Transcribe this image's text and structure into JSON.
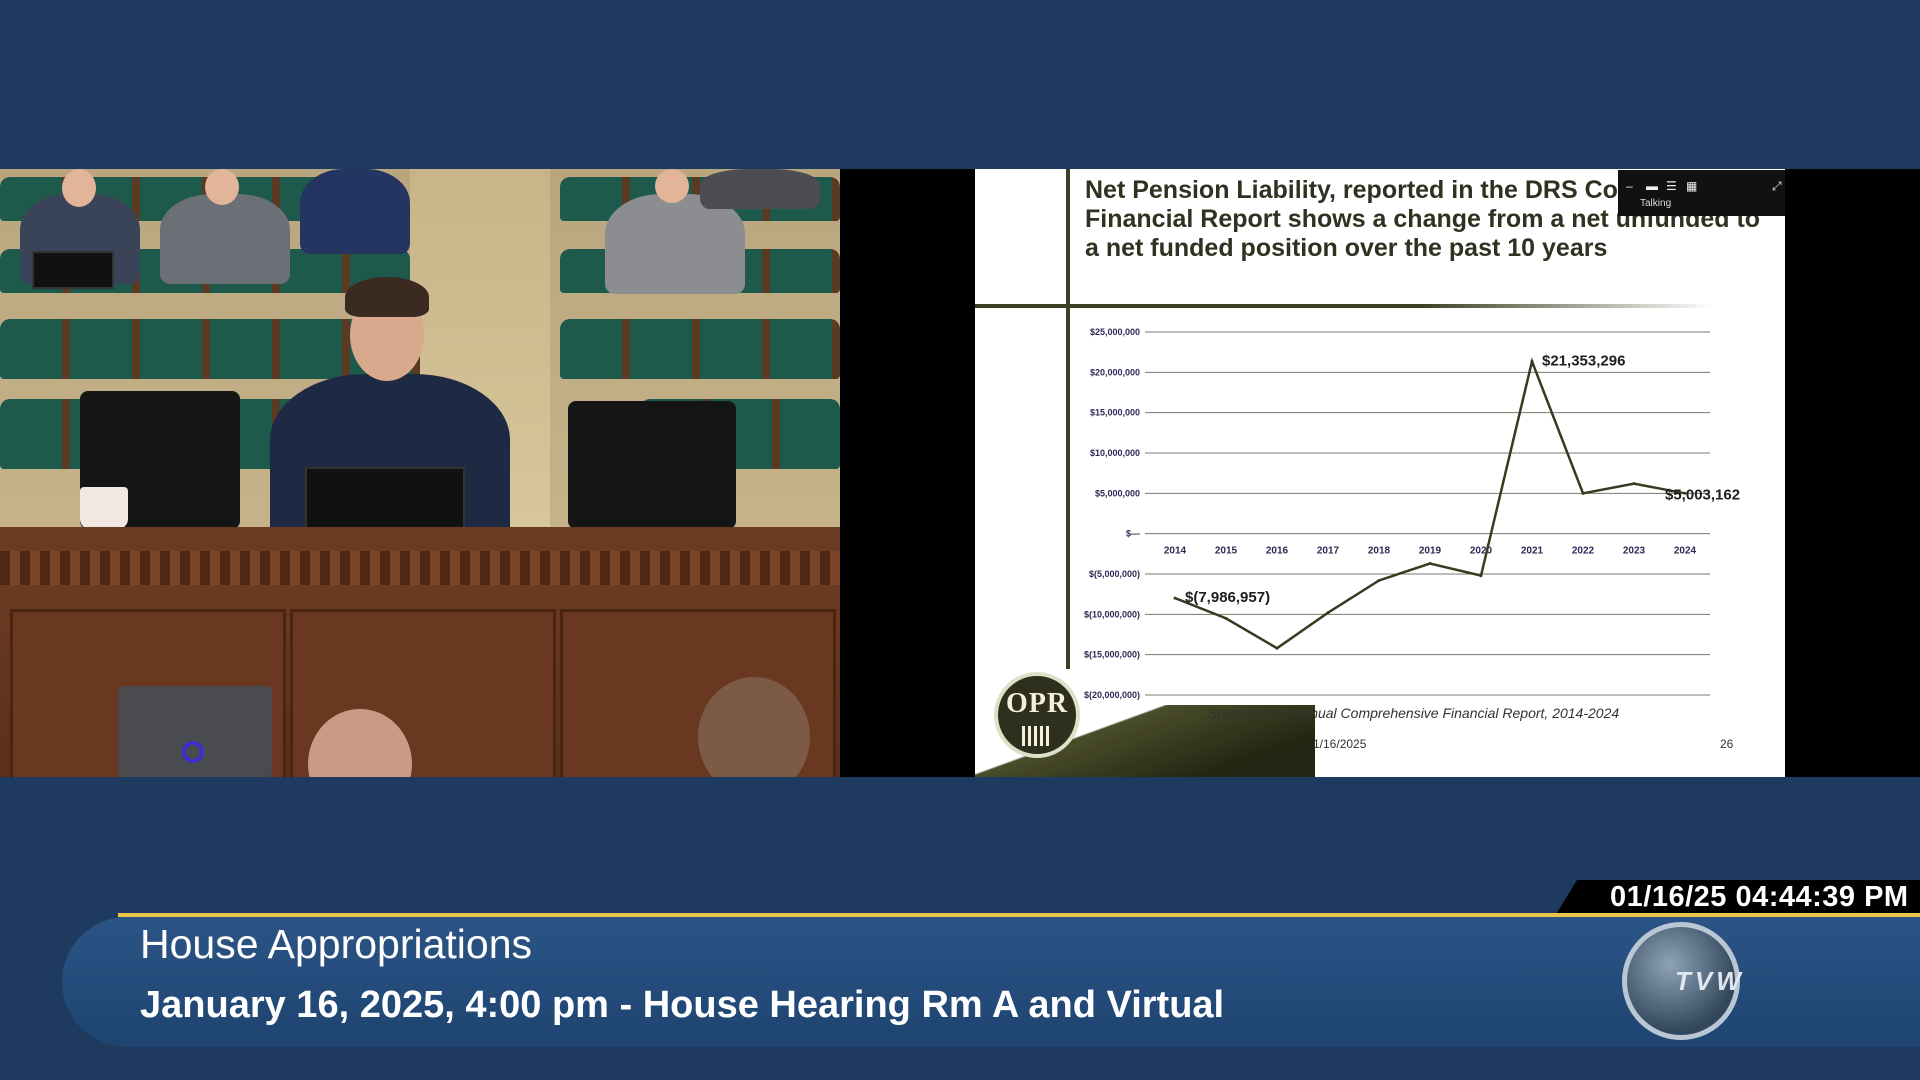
{
  "slide": {
    "title": "Net Pension Liability, reported in the DRS Comprehensive Financial Report shows a change from a net unfunded to a net funded position over the past 10 years",
    "source": "Source:  DRS Annual Comprehensive Financial Report, 2014-2024",
    "date": "1/16/2025",
    "page": "26",
    "logo_text": "OPR"
  },
  "chart_data": {
    "type": "line",
    "x": [
      "2014",
      "2015",
      "2016",
      "2017",
      "2018",
      "2019",
      "2020",
      "2021",
      "2022",
      "2023",
      "2024"
    ],
    "series": [
      {
        "values": [
          -7986957,
          -10500000,
          -14200000,
          -9800000,
          -5800000,
          -3700000,
          -5200000,
          21353296,
          5000000,
          6200000,
          5003162
        ]
      }
    ],
    "ylim": [
      -20000000,
      25000000
    ],
    "y_ticks": [
      25000000,
      20000000,
      15000000,
      10000000,
      5000000,
      0,
      -5000000,
      -10000000,
      -15000000,
      -20000000
    ],
    "y_tick_labels": [
      "$25,000,000",
      "$20,000,000",
      "$15,000,000",
      "$10,000,000",
      "$5,000,000",
      "$—",
      "$(5,000,000)",
      "$(10,000,000)",
      "$(15,000,000)",
      "$(20,000,000)"
    ],
    "annotations": [
      {
        "label": "$(7,986,957)",
        "x": "2014",
        "y": -7986957
      },
      {
        "label": "$21,353,296",
        "x": "2021",
        "y": 21353296
      },
      {
        "label": "$5,003,162",
        "x": "2024",
        "y": 5003162
      }
    ],
    "grid": true,
    "line_color": "#3a3a22"
  },
  "overlay": {
    "talking_label": "Talking"
  },
  "broadcast": {
    "timestamp": "01/16/25 04:44:39 PM",
    "title": "House Appropriations",
    "subtitle": "January 16, 2025, 4:00 pm - House Hearing Rm A and Virtual",
    "network_logo": "TVW",
    "accent_gold": "#e9c64a",
    "banner_blue": "#2b5486"
  }
}
